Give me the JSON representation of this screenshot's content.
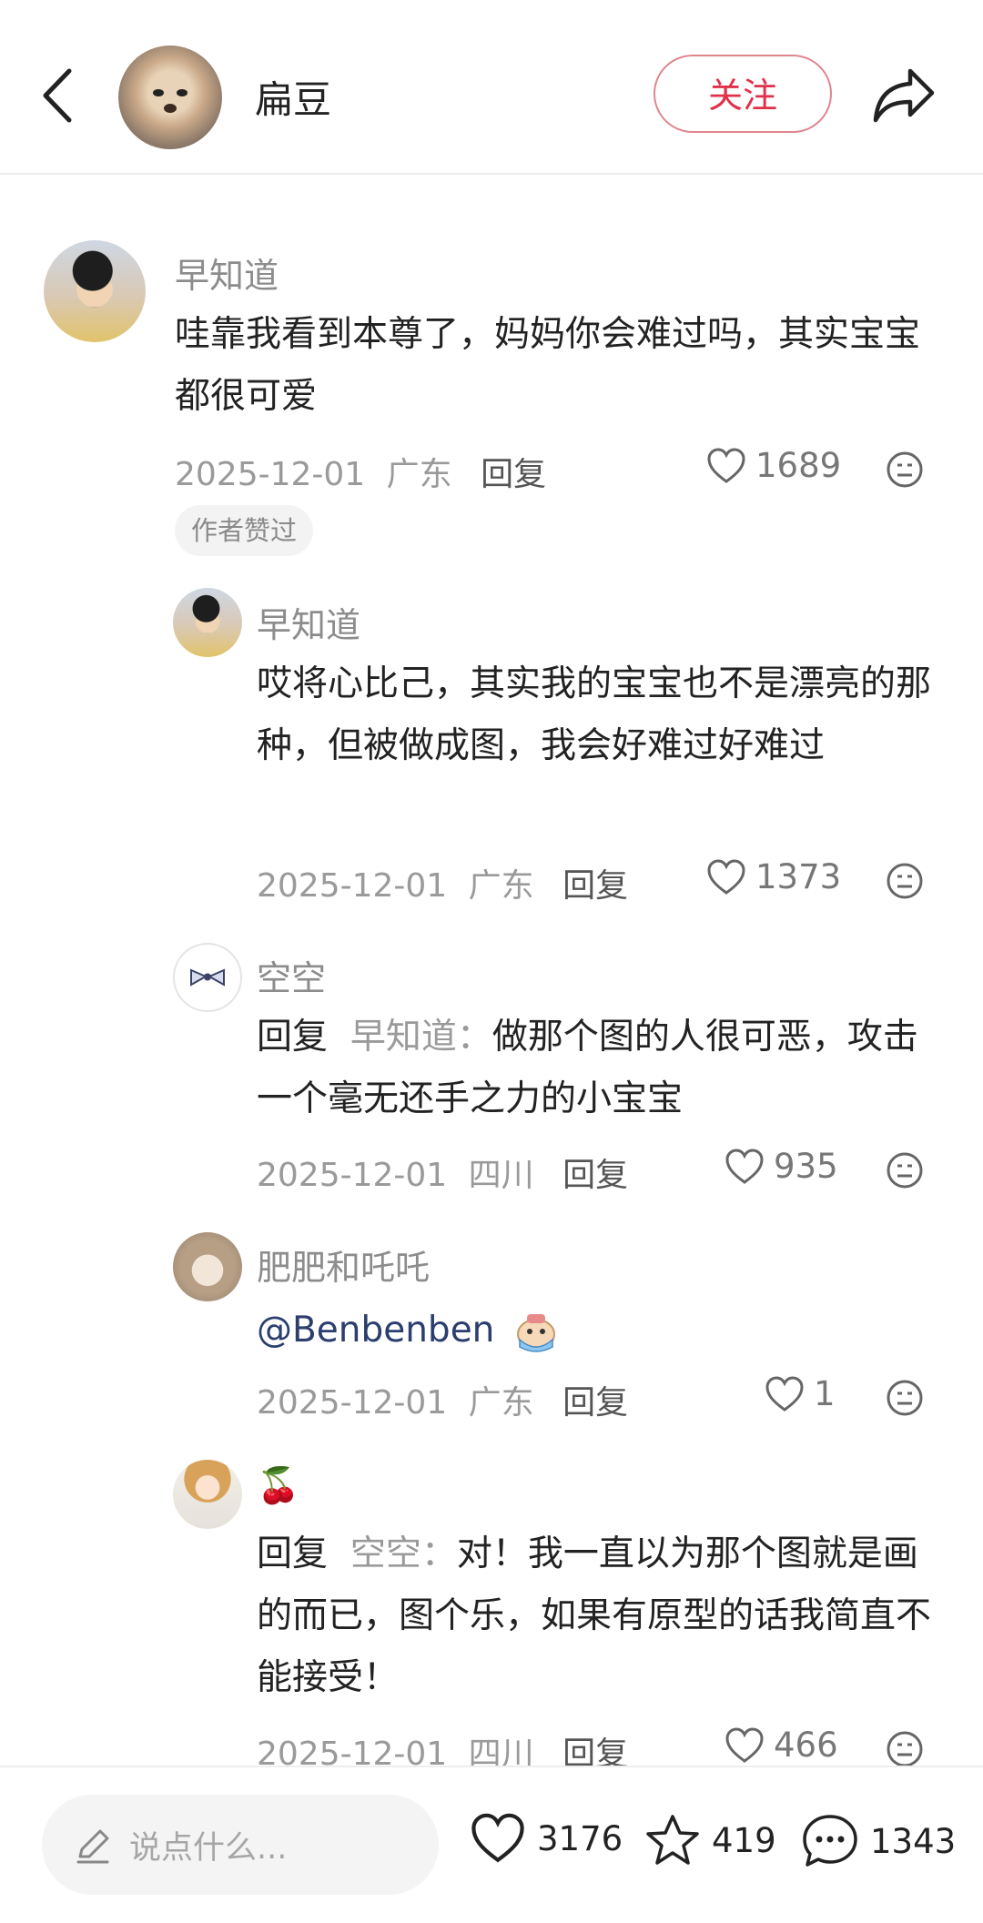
{
  "header": {
    "author_name": "扁豆",
    "follow_label": "关注"
  },
  "comments": [
    {
      "nick": "早知道",
      "text": "哇靠我看到本尊了，妈妈你会难过吗，其实宝宝都很可爱",
      "date": "2025-12-01",
      "location": "广东",
      "reply_label": "回复",
      "likes": "1689",
      "badge": "作者赞过"
    },
    {
      "nick": "早知道",
      "text": "哎将心比己，其实我的宝宝也不是漂亮的那种，但被做成图，我会好难过好难过",
      "date": "2025-12-01",
      "location": "广东",
      "reply_label": "回复",
      "likes": "1373"
    },
    {
      "nick": "空空",
      "reply_prefix": "回复",
      "reply_to": "早知道：",
      "text": "做那个图的人很可恶，攻击一个毫无还手之力的小宝宝",
      "date": "2025-12-01",
      "location": "四川",
      "reply_label": "回复",
      "likes": "935"
    },
    {
      "nick": "肥肥和吒吒",
      "text": "@Benbenben",
      "date": "2025-12-01",
      "location": "广东",
      "reply_label": "回复",
      "likes": "1"
    },
    {
      "nick": "🍒",
      "reply_prefix": "回复",
      "reply_to": "空空：",
      "text": "对！我一直以为那个图就是画的而已，图个乐，如果有原型的话我简直不能接受！",
      "date": "2025-12-01",
      "location": "四川",
      "reply_label": "回复",
      "likes": "466"
    }
  ],
  "bottom_bar": {
    "input_placeholder": "说点什么...",
    "likes": "3176",
    "favorites": "419",
    "comments": "1343"
  },
  "colors": {
    "follow_accent": "#e0304a",
    "mention": "#2b3e6e"
  }
}
